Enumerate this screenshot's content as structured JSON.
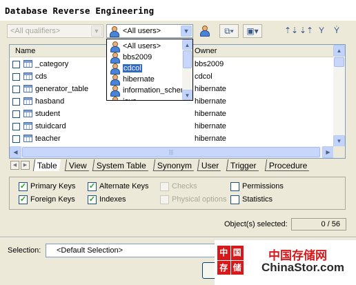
{
  "window": {
    "title": "Database Reverse Engineering"
  },
  "toolbar": {
    "qualifier_value": "<All qualifiers>",
    "user_value": "<All users>"
  },
  "user_dropdown": {
    "items": [
      {
        "label": "<All users>"
      },
      {
        "label": "bbs2009"
      },
      {
        "label": "cdcol",
        "selected": true
      },
      {
        "label": "hibernate"
      },
      {
        "label": "information_schema"
      },
      {
        "label": "javo"
      }
    ]
  },
  "list": {
    "columns": {
      "name": "Name",
      "owner": "Owner"
    },
    "rows": [
      {
        "name": "_category",
        "owner": "bbs2009"
      },
      {
        "name": "cds",
        "owner": "cdcol"
      },
      {
        "name": "generator_table",
        "owner": "hibernate"
      },
      {
        "name": "hasband",
        "owner": "hibernate"
      },
      {
        "name": "student",
        "owner": "hibernate"
      },
      {
        "name": "stuidcard",
        "owner": "hibernate"
      },
      {
        "name": "teacher",
        "owner": "hibernate"
      }
    ]
  },
  "tabs": [
    "Table",
    "View",
    "System Table",
    "Synonym",
    "User",
    "Trigger",
    "Procedure"
  ],
  "options": {
    "primary_keys": {
      "label": "Primary Keys",
      "checked": true
    },
    "alternate_keys": {
      "label": "Alternate Keys",
      "checked": true
    },
    "checks": {
      "label": "Checks",
      "checked": false,
      "disabled": true
    },
    "permissions": {
      "label": "Permissions",
      "checked": false
    },
    "foreign_keys": {
      "label": "Foreign Keys",
      "checked": true
    },
    "indexes": {
      "label": "Indexes",
      "checked": true
    },
    "physical_options": {
      "label": "Physical options",
      "checked": false,
      "disabled": true
    },
    "statistics": {
      "label": "Statistics",
      "checked": false
    }
  },
  "selection_status": {
    "label": "Object(s) selected:",
    "value": "0 / 56"
  },
  "selection": {
    "label": "Selection:",
    "value": "<Default Selection>"
  },
  "watermark": {
    "logo_chars": [
      "中",
      "国",
      "存",
      "储"
    ],
    "cn_text": "中国存储网",
    "en_text": "ChinaStor.com"
  },
  "colors": {
    "checkmark": "#21a121",
    "selection_highlight": "#316ac5",
    "watermark_red": "#d7191b"
  }
}
